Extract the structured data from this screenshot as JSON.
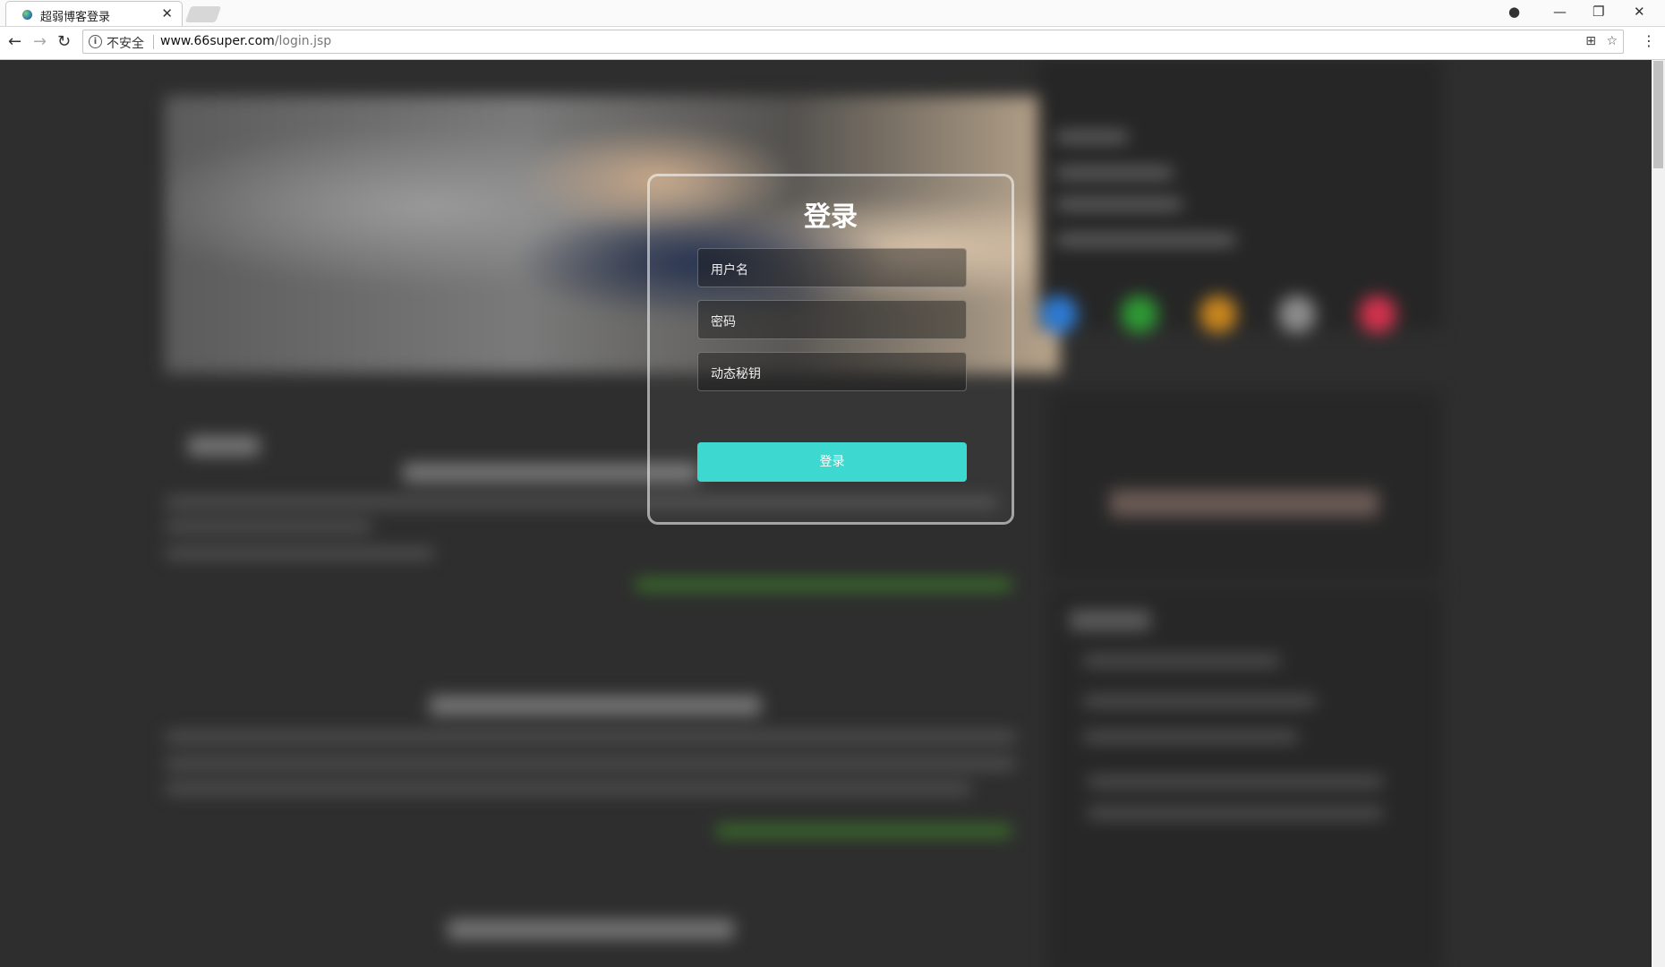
{
  "browser": {
    "tab_title": "超弱博客登录",
    "tab_close": "✕",
    "security_label": "不安全",
    "url_host": "www.66super.com",
    "url_path": "/login.jsp",
    "window_controls": {
      "minimize": "—",
      "restore": "❐",
      "close": "✕"
    }
  },
  "login": {
    "title": "登录",
    "username_placeholder": "用户名",
    "password_placeholder": "密码",
    "dynamic_key_placeholder": "动态秘钥",
    "submit_label": "登录",
    "button_color": "#3dd9d1"
  },
  "icons": [
    "back-icon",
    "forward-icon",
    "reload-icon",
    "info-icon",
    "translate-icon",
    "star-icon",
    "menu-icon",
    "account-icon"
  ]
}
